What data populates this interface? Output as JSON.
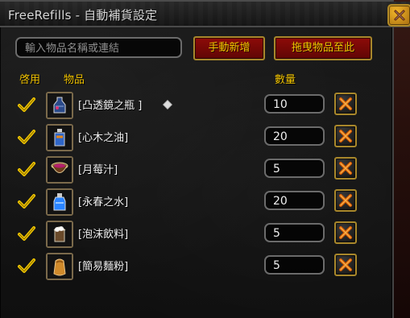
{
  "window": {
    "title": "FreeRefills - 自動補貨設定"
  },
  "toolbar": {
    "search_placeholder": "輸入物品名稱或連結",
    "add_button_label": "手動新增",
    "drag_button_label": "拖曳物品至此"
  },
  "table": {
    "headers": {
      "enable": "啓用",
      "item": "物品",
      "qty": "數量"
    },
    "rows": [
      {
        "enabled": true,
        "icon": "flask-icon",
        "name": "[凸透鏡之瓶 ]",
        "has_diamond": true,
        "qty": "10"
      },
      {
        "enabled": true,
        "icon": "oil-bottle-icon",
        "name": "[心木之油]",
        "has_diamond": false,
        "qty": "20"
      },
      {
        "enabled": true,
        "icon": "juice-cup-icon",
        "name": "[月莓汁]",
        "has_diamond": false,
        "qty": "5"
      },
      {
        "enabled": true,
        "icon": "water-bottle-icon",
        "name": "[永春之水]",
        "has_diamond": false,
        "qty": "20"
      },
      {
        "enabled": true,
        "icon": "foam-drink-icon",
        "name": "[泡沫飲料]",
        "has_diamond": false,
        "qty": "5"
      },
      {
        "enabled": true,
        "icon": "flour-sack-icon",
        "name": "[簡易麵粉]",
        "has_diamond": false,
        "qty": "5"
      }
    ]
  },
  "colors": {
    "accent_yellow": "#f0c200",
    "button_red": "#8e0b08",
    "button_border_gold": "#a8872b"
  }
}
